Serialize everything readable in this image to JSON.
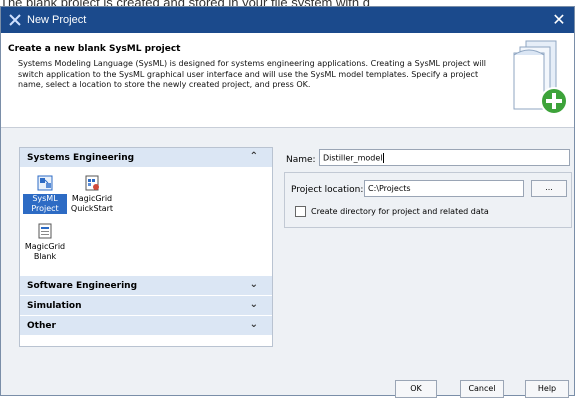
{
  "background_text": "The blank project is created and stored in your file system with d",
  "window": {
    "title": "New Project",
    "close_glyph": "✕",
    "accent": "#1b4a8c"
  },
  "header": {
    "title": "Create a new blank SysML project",
    "description": "Systems Modeling Language (SysML) is designed for systems engineering applications. Creating a SysML project will switch application to the SysML graphical user interface and will use the SysML model templates. Specify a project name, select a location to store the newly created project, and press OK."
  },
  "categories": [
    {
      "label": "Systems Engineering",
      "chevron": "≈",
      "expanded": true
    },
    {
      "label": "Software Engineering",
      "chevron": "≫"
    },
    {
      "label": "Simulation",
      "chevron": "≫"
    },
    {
      "label": "Other",
      "chevron": "≫"
    }
  ],
  "templates": [
    {
      "label_line1": "SysML",
      "label_line2": "Project",
      "selected": true,
      "icon": "sysml-project-icon"
    },
    {
      "label_line1": "MagicGrid",
      "label_line2": "QuickStart",
      "icon": "magicgrid-quickstart-icon"
    },
    {
      "label_line1": "MagicGrid",
      "label_line2": "Blank",
      "icon": "magicgrid-blank-icon"
    }
  ],
  "form": {
    "name_label": "Name:",
    "name_value": "Distiller_model",
    "location_label": "Project location:",
    "location_value": "C:\\Projects",
    "browse_label": "...",
    "checkbox_label": "Create directory for project and related data",
    "checkbox_checked": false
  },
  "buttons": {
    "ok": "OK",
    "cancel": "Cancel",
    "help": "Help"
  }
}
